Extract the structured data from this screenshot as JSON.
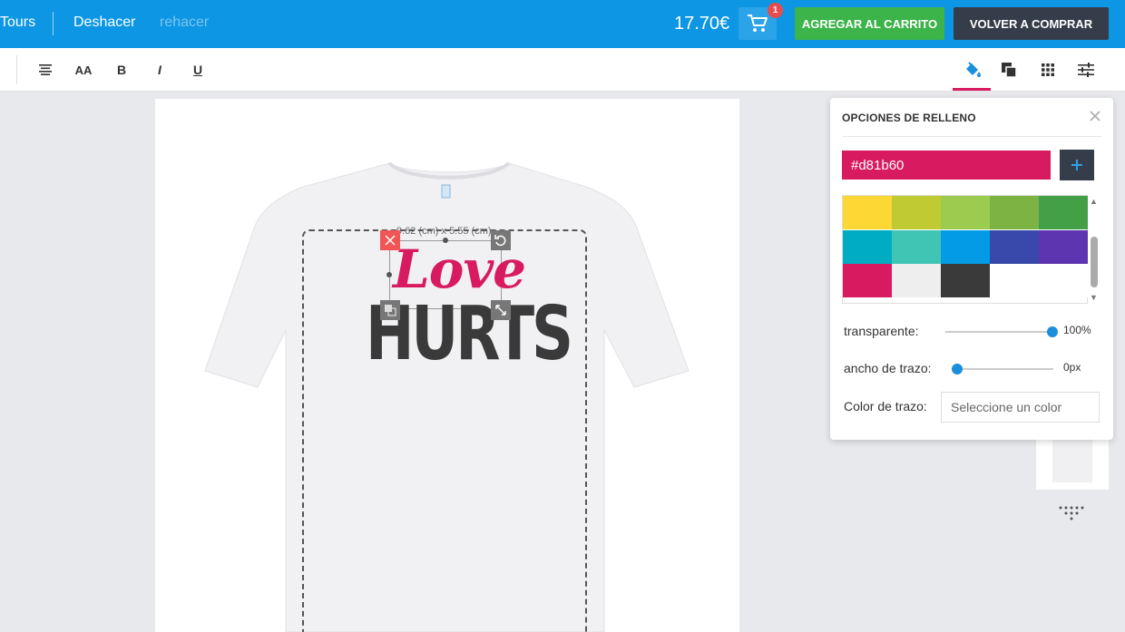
{
  "topbar": {
    "tours": "Tours",
    "undo": "Deshacer",
    "redo": "rehacer",
    "price": "17.70€",
    "cart_count": "1",
    "add_to_cart": "AGREGAR AL CARRITO",
    "back_to_shop": "VOLVER A COMPRAR"
  },
  "toolbar": {
    "size_label": "AA",
    "bold_label": "B",
    "italic_label": "I",
    "underline_label": "U"
  },
  "canvas": {
    "dimension_label": "9.62 (cm) x 5.55 (cm)",
    "design_line1": "Love",
    "design_line2": "HURTS"
  },
  "fill_panel": {
    "title": "OPCIONES DE RELLENO",
    "hex_value": "#d81b60",
    "swatches": [
      "#fdd835",
      "#c0ca33",
      "#9ccc4f",
      "#7cb342",
      "#43a047",
      "#00acc1",
      "#40c4b4",
      "#039be5",
      "#3949ab",
      "#5e35b1",
      "#d81b60",
      "#eeeeee",
      "#3a3a3a",
      "#ffffff",
      "#ffffff"
    ],
    "transparency_label": "transparente:",
    "transparency_value": "100%",
    "transparency_level": 100,
    "stroke_width_label": "ancho de trazo:",
    "stroke_width_value": "0px",
    "stroke_width_level": 0,
    "stroke_color_label": "Color de trazo:",
    "stroke_color_placeholder": "Seleccione un color"
  },
  "colors": {
    "topbar": "#0c96e3",
    "accent": "#d81b60",
    "add_button": "#3cb44a",
    "back_button": "#363d4a"
  }
}
